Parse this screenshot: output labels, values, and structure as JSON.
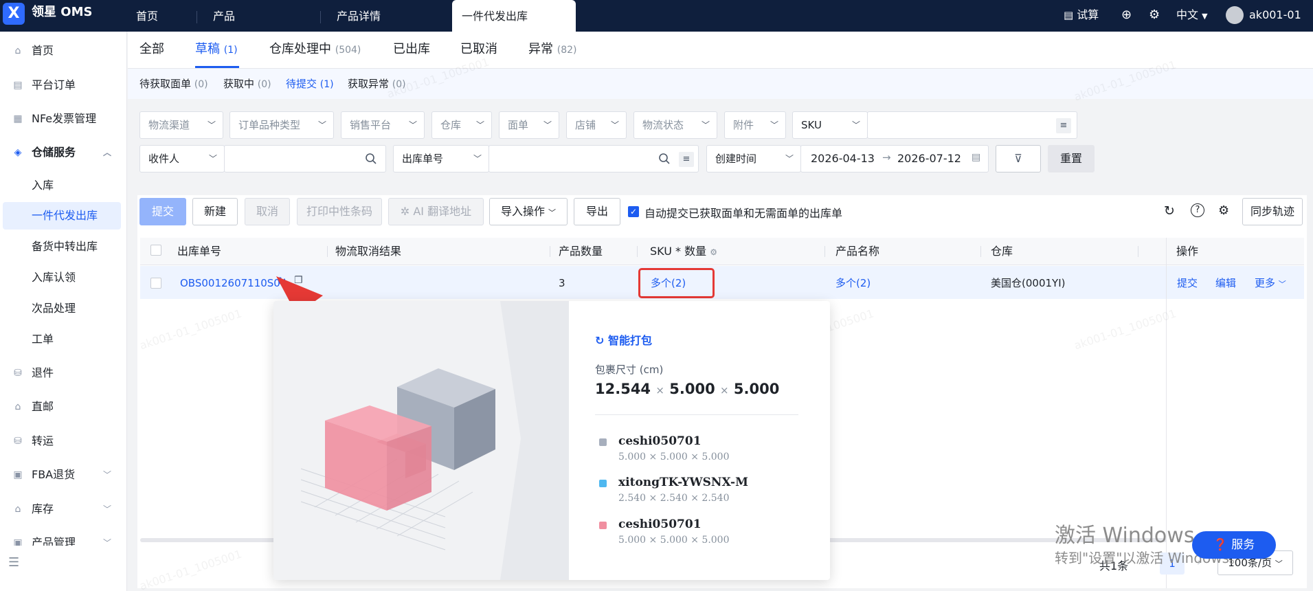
{
  "app": {
    "logo_letter": "X",
    "brand": "领星 OMS"
  },
  "topnav": {
    "items": [
      "首页",
      "产品",
      "产品详情"
    ],
    "active_tab": "一件代发出库",
    "calc": "试算",
    "lang": "中文",
    "user": "ak001-01"
  },
  "sidebar": {
    "items": [
      {
        "label": "首页",
        "icon": "home-icon"
      },
      {
        "label": "平台订单",
        "icon": "clipboard-icon"
      },
      {
        "label": "NFe发票管理",
        "icon": "invoice-icon"
      },
      {
        "label": "仓储服务",
        "icon": "warehouse-icon",
        "active": true
      },
      {
        "label": "退件",
        "icon": "return-icon"
      },
      {
        "label": "直邮",
        "icon": "mail-icon"
      },
      {
        "label": "转运",
        "icon": "transfer-icon"
      },
      {
        "label": "FBA退货",
        "icon": "amazon-icon"
      },
      {
        "label": "库存",
        "icon": "inventory-icon"
      },
      {
        "label": "产品管理",
        "icon": "product-icon"
      }
    ],
    "subitems": [
      "入库",
      "一件代发出库",
      "备货中转出库",
      "入库认领",
      "次品处理",
      "工单"
    ]
  },
  "tabs_primary": [
    {
      "label": "全部",
      "count": ""
    },
    {
      "label": "草稿",
      "count": "(1)"
    },
    {
      "label": "仓库处理中",
      "count": "(504)"
    },
    {
      "label": "已出库",
      "count": ""
    },
    {
      "label": "已取消",
      "count": ""
    },
    {
      "label": "异常",
      "count": "(82)"
    }
  ],
  "tabs_secondary": [
    {
      "label": "待获取面单",
      "count": "(0)"
    },
    {
      "label": "获取中",
      "count": "(0)"
    },
    {
      "label": "待提交",
      "count": "(1)"
    },
    {
      "label": "获取异常",
      "count": "(0)"
    }
  ],
  "filters": {
    "row1": [
      "物流渠道",
      "订单品种类型",
      "销售平台",
      "仓库",
      "面单",
      "店铺",
      "物流状态",
      "附件"
    ],
    "sku_select": "SKU",
    "recipient_select": "收件人",
    "order_no_select": "出库单号",
    "time_select": "创建时间",
    "date_from": "2026-04-13",
    "date_to": "2026-07-12",
    "reset": "重置"
  },
  "toolbar": {
    "submit": "提交",
    "new": "新建",
    "cancel": "取消",
    "print_barcode": "打印中性条码",
    "ai_translate": "AI 翻译地址",
    "import": "导入操作",
    "export": "导出",
    "auto_submit_label": "自动提交已获取面单和无需面单的出库单",
    "sync": "同步轨迹"
  },
  "table": {
    "headers": [
      "出库单号",
      "物流取消结果",
      "产品数量",
      "SKU * 数量",
      "产品名称",
      "仓库",
      "操作"
    ],
    "rows": [
      {
        "order_no": "OBS0012607110S0",
        "cancel_result": "",
        "qty": "3",
        "sku_qty": "多个(2)",
        "product_name": "多个(2)",
        "warehouse": "美国仓(0001YI)",
        "actions": [
          "提交",
          "编辑",
          "更多"
        ]
      }
    ]
  },
  "popover": {
    "title": "智能打包",
    "size_label": "包裹尺寸 (cm)",
    "size": [
      "12.544",
      "5.000",
      "5.000"
    ],
    "items": [
      {
        "name": "ceshi050701",
        "dims": "5.000 × 5.000 × 5.000",
        "color": "#a7afbd"
      },
      {
        "name": "xitongTK-YWSNX-M",
        "dims": "2.540 × 2.540 × 2.540",
        "color": "#4fb8f0"
      },
      {
        "name": "ceshi050701",
        "dims": "5.000 × 5.000 × 5.000",
        "color": "#f08fa0"
      }
    ]
  },
  "pagination": {
    "total": "共1条",
    "page": "1",
    "page_size": "100条/页"
  },
  "watermark": "ak001-01_1005001",
  "windows": {
    "line1": "激活 Windows",
    "line2": "转到\"设置\"以激活 Windows。"
  },
  "service_button": "服务",
  "colors": {
    "primary": "#1d5cf0",
    "topbar": "#0f1f3d",
    "highlight_box": "#e53935",
    "arrow": "#e53935"
  }
}
